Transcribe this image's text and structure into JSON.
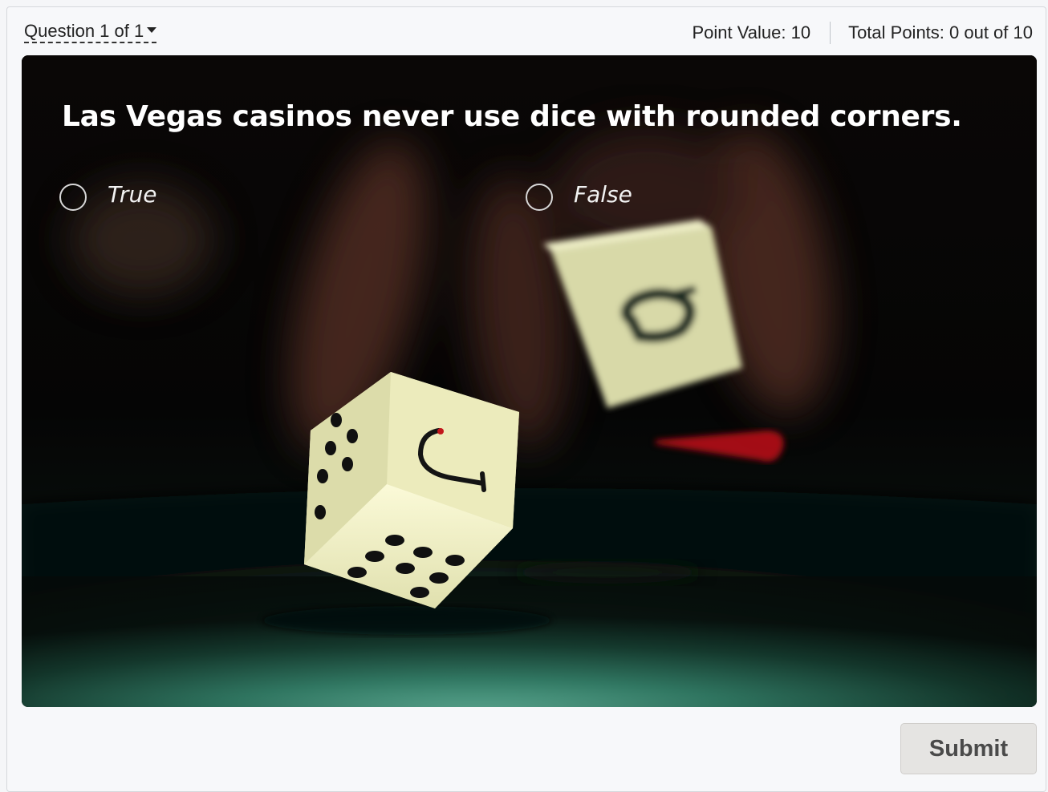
{
  "header": {
    "question_nav_label": "Question 1 of 1",
    "point_value": "Point Value: 10",
    "total_points": "Total Points: 0 out of 10"
  },
  "question": {
    "text": "Las Vegas casinos never use dice with rounded corners.",
    "options": [
      {
        "label": "True",
        "selected": false
      },
      {
        "label": "False",
        "selected": false
      }
    ]
  },
  "actions": {
    "submit_label": "Submit"
  },
  "icons": {
    "dropdown": "chevron-down-icon",
    "radio": "radio-empty-icon"
  },
  "colors": {
    "question_text": "#ffffff",
    "felt_green": "#2f6f5a",
    "button_bg": "#e5e4e2"
  }
}
